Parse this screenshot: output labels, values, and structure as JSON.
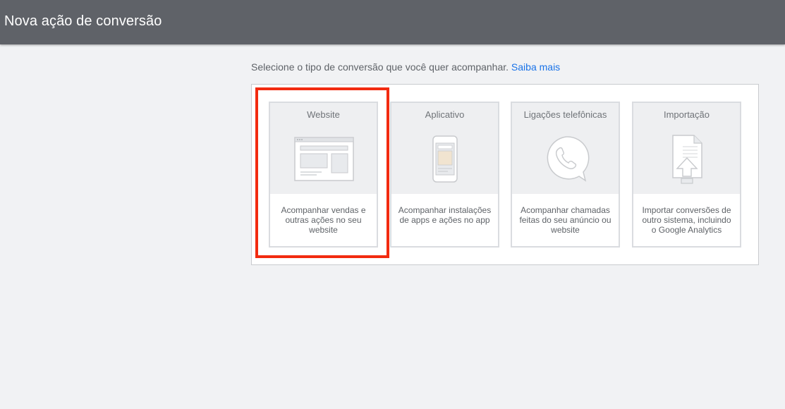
{
  "header": {
    "title": "Nova ação de conversão"
  },
  "intro": {
    "text": "Selecione o tipo de conversão que você quer acompanhar.",
    "link": "Saiba mais"
  },
  "colors": {
    "header_bg": "#5f6268",
    "page_bg": "#f1f2f4",
    "link": "#1a73e8",
    "highlight": "#f22b10"
  },
  "cards": [
    {
      "label": "Website",
      "description": "Acompanhar vendas e outras ações no seu website",
      "icon": "website-icon"
    },
    {
      "label": "Aplicativo",
      "description": "Acompanhar instalações de apps e ações no app",
      "icon": "smartphone-icon"
    },
    {
      "label": "Ligações telefônicas",
      "description": "Acompanhar chamadas feitas do seu anúncio ou website",
      "icon": "phone-call-icon"
    },
    {
      "label": "Importação",
      "description": "Importar conversões de outro sistema, incluindo o Google Analytics",
      "icon": "file-upload-icon"
    }
  ]
}
